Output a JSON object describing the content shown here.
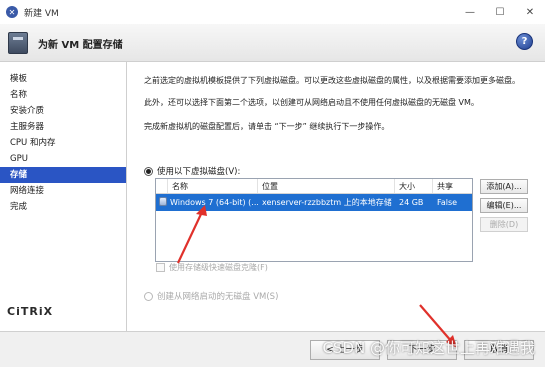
{
  "window": {
    "title": "新建 VM",
    "controls": {
      "minimize": "—",
      "maximize": "☐",
      "close": "✕"
    }
  },
  "header": {
    "title": "为新 VM 配置存储",
    "help_label": "?"
  },
  "sidebar": {
    "items": [
      {
        "label": "模板",
        "active": false
      },
      {
        "label": "名称",
        "active": false
      },
      {
        "label": "安装介质",
        "active": false
      },
      {
        "label": "主服务器",
        "active": false
      },
      {
        "label": "CPU 和内存",
        "active": false
      },
      {
        "label": "GPU",
        "active": false
      },
      {
        "label": "存储",
        "active": true
      },
      {
        "label": "网络连接",
        "active": false
      },
      {
        "label": "完成",
        "active": false
      }
    ],
    "logo": "CiTRiX"
  },
  "main": {
    "intro_line1": "之前选定的虚拟机模板提供了下列虚拟磁盘。可以更改这些虚拟磁盘的属性，以及根据需要添加更多磁盘。",
    "intro_line2": "此外，还可以选择下面第二个选项，以创建可从网络启动且不使用任何虚拟磁盘的无磁盘 VM。",
    "intro_line3": "完成新虚拟机的磁盘配置后，请单击 “下一步” 继续执行下一步操作。",
    "option_disks": "使用以下虚拟磁盘(V):",
    "option_diskless": "创建从网络启动的无磁盘 VM(S)",
    "fast_clone_label": "使用存储级快速磁盘克隆(F)",
    "table": {
      "columns": [
        "名称",
        "位置",
        "大小",
        "共享"
      ],
      "rows": [
        {
          "name": "Windows 7 (64-bit) (...",
          "location": "xenserver-rzzbbztm 上的本地存储",
          "size": "24 GB",
          "shared": "False"
        }
      ]
    },
    "buttons": {
      "add": "添加(A)...",
      "edit": "编辑(E)...",
      "delete": "删除(D)"
    }
  },
  "footer": {
    "back": "< 上一步",
    "next": "下一步",
    "cancel": "取消"
  },
  "watermark": "CSDN @你可知这世上再难遇我",
  "colors": {
    "selection": "#1f6fd1",
    "active_nav": "#2a55c4",
    "arrow": "#e0312b"
  }
}
